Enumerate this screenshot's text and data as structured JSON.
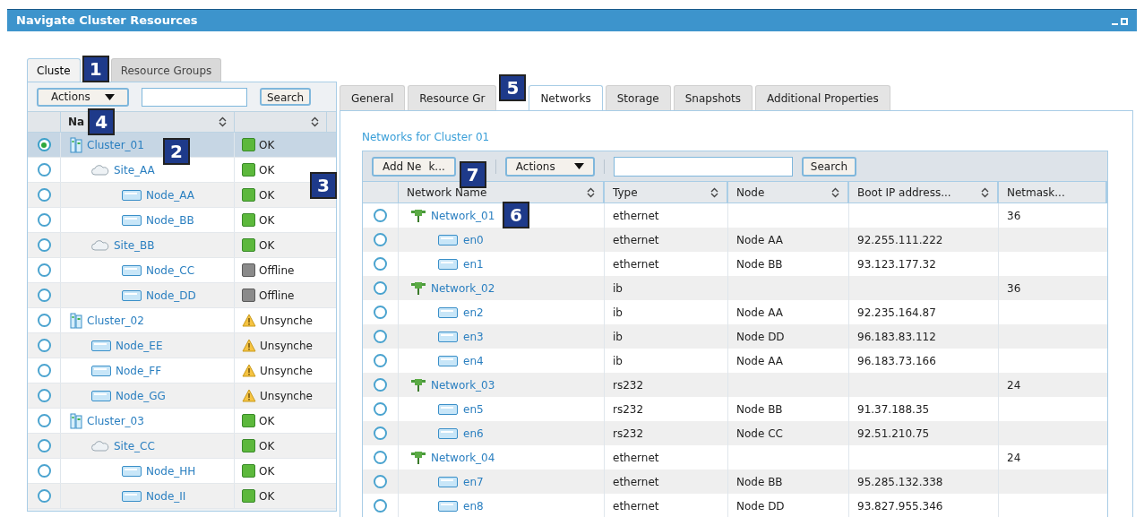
{
  "window": {
    "title": "Navigate Cluster Resources"
  },
  "left_panel": {
    "tabs": [
      {
        "label": "Cluste",
        "selected": true
      },
      {
        "label": "Resource Groups",
        "selected": false
      }
    ],
    "actions_button": "Actions",
    "search_button": "Search",
    "columns": [
      "Na",
      ""
    ],
    "rows": [
      {
        "name": "Cluster_01",
        "kind": "cluster",
        "status_icon": {
          "kind": "ok"
        },
        "status": "OK",
        "selected": true,
        "children": [
          {
            "name": "Site_AA",
            "kind": "site",
            "status_icon": {
              "kind": "ok"
            },
            "status": "OK",
            "selected": false,
            "children": [
              {
                "name": "Node_AA",
                "kind": "node",
                "status_icon": {
                  "kind": "ok"
                },
                "status": "OK",
                "selected": false
              },
              {
                "name": "Node_BB",
                "kind": "node",
                "status_icon": {
                  "kind": "ok"
                },
                "status": "OK",
                "selected": false
              }
            ]
          },
          {
            "name": "Site_BB",
            "kind": "site",
            "status_icon": {
              "kind": "ok"
            },
            "status": "OK",
            "selected": false,
            "children": [
              {
                "name": "Node_CC",
                "kind": "node",
                "status_icon": {
                  "kind": "offline"
                },
                "status": "Offline",
                "selected": false
              },
              {
                "name": "Node_DD",
                "kind": "node",
                "status_icon": {
                  "kind": "offline"
                },
                "status": "Offline",
                "selected": false
              }
            ]
          }
        ]
      },
      {
        "name": "Cluster_02",
        "kind": "cluster",
        "status_icon": {
          "kind": "warning"
        },
        "status": "Unsynche",
        "selected": false,
        "children": [
          {
            "name": "Node_EE",
            "kind": "node",
            "status_icon": {
              "kind": "warning"
            },
            "status": "Unsynche",
            "selected": false
          },
          {
            "name": "Node_FF",
            "kind": "node",
            "status_icon": {
              "kind": "warning"
            },
            "status": "Unsynche",
            "selected": false
          },
          {
            "name": "Node_GG",
            "kind": "node",
            "status_icon": {
              "kind": "warning"
            },
            "status": "Unsynche",
            "selected": false
          }
        ]
      },
      {
        "name": "Cluster_03",
        "kind": "cluster",
        "status_icon": {
          "kind": "ok"
        },
        "status": "OK",
        "selected": false,
        "children": [
          {
            "name": "Site_CC",
            "kind": "site",
            "status_icon": {
              "kind": "ok"
            },
            "status": "OK",
            "selected": false,
            "children": [
              {
                "name": "Node_HH",
                "kind": "node",
                "status_icon": {
                  "kind": "ok"
                },
                "status": "OK",
                "selected": false
              },
              {
                "name": "Node_II",
                "kind": "node",
                "status_icon": {
                  "kind": "ok"
                },
                "status": "OK",
                "selected": false
              }
            ]
          }
        ]
      }
    ]
  },
  "right_panel": {
    "tabs": [
      {
        "label": "General",
        "selected": false
      },
      {
        "label": "Resource Gr",
        "selected": false
      },
      {
        "label": "Networks",
        "selected": true
      },
      {
        "label": "Storage",
        "selected": false
      },
      {
        "label": "Snapshots",
        "selected": false
      },
      {
        "label": "Additional Properties",
        "selected": false
      }
    ],
    "heading": "Networks for Cluster 01",
    "add_button": [
      "Add Ne",
      "k..."
    ],
    "actions_button": "Actions",
    "search_button": "Search",
    "columns": [
      {
        "label": "Network Name",
        "sortable": true
      },
      {
        "label": "Type",
        "sortable": true
      },
      {
        "label": "Node",
        "sortable": true
      },
      {
        "label": "Boot IP address...",
        "sortable": true
      },
      {
        "label": "Netmask...",
        "sortable": false
      }
    ],
    "rows": [
      {
        "name": "Network_01",
        "kind": "network",
        "type": "ethernet",
        "netmask": "36",
        "selected": false,
        "children": [
          {
            "name": "en0",
            "kind": "interface",
            "type": "ethernet",
            "node": "Node AA",
            "ip": "92.255.111.222",
            "selected": false
          },
          {
            "name": "en1",
            "kind": "interface",
            "type": "ethernet",
            "node": "Node BB",
            "ip": "93.123.177.32",
            "selected": false
          }
        ]
      },
      {
        "name": "Network_02",
        "kind": "network",
        "type": "ib",
        "netmask": "36",
        "selected": false,
        "children": [
          {
            "name": "en2",
            "kind": "interface",
            "type": "ib",
            "node": "Node AA",
            "ip": "92.235.164.87",
            "selected": false
          },
          {
            "name": "en3",
            "kind": "interface",
            "type": "ib",
            "node": "Node DD",
            "ip": "96.183.83.112",
            "selected": false
          },
          {
            "name": "en4",
            "kind": "interface",
            "type": "ib",
            "node": "Node AA",
            "ip": "96.183.73.166",
            "selected": false
          }
        ]
      },
      {
        "name": "Network_03",
        "kind": "network",
        "type": "rs232",
        "netmask": "24",
        "selected": false,
        "children": [
          {
            "name": "en5",
            "kind": "interface",
            "type": "rs232",
            "node": "Node BB",
            "ip": "91.37.188.35",
            "selected": false
          },
          {
            "name": "en6",
            "kind": "interface",
            "type": "rs232",
            "node": "Node CC",
            "ip": "92.51.210.75",
            "selected": false
          }
        ]
      },
      {
        "name": "Network_04",
        "kind": "network",
        "type": "ethernet",
        "netmask": "24",
        "selected": false,
        "children": [
          {
            "name": "en7",
            "kind": "interface",
            "type": "ethernet",
            "node": "Node BB",
            "ip": "95.285.132.338",
            "selected": false
          },
          {
            "name": "en8",
            "kind": "interface",
            "type": "ethernet",
            "node": "Node DD",
            "ip": "93.827.955.346",
            "selected": false
          }
        ]
      }
    ]
  },
  "callouts": [
    "1",
    "2",
    "3",
    "4",
    "5",
    "6",
    "7"
  ]
}
